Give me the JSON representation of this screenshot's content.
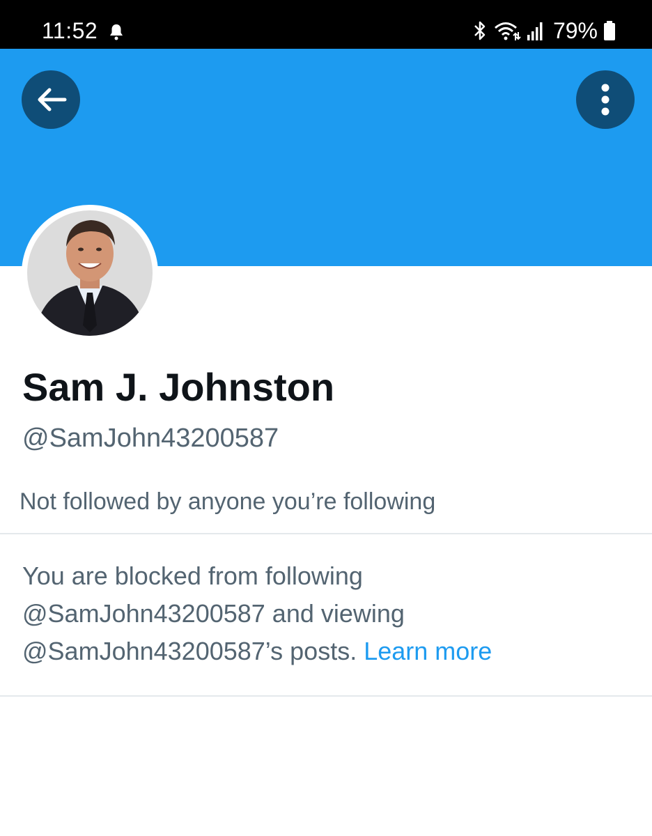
{
  "status_bar": {
    "time": "11:52",
    "battery": "79%",
    "icons": [
      "notification-bell-icon",
      "bluetooth-icon",
      "wifi-icon",
      "cellular-signal-icon",
      "battery-icon"
    ]
  },
  "colors": {
    "banner": "#1d9bf0",
    "round_button": "#0f4d77",
    "name_text": "#0f1419",
    "secondary_text": "#536471",
    "link": "#1d9bf0",
    "divider": "#e4e9ec"
  },
  "header": {
    "back_icon": "arrow-left-icon",
    "more_icon": "more-vertical-icon"
  },
  "profile": {
    "name": "Sam J. Johnston",
    "handle": "@SamJohn43200587",
    "followed_by": "Not followed by anyone you’re following"
  },
  "blocked_notice": {
    "line1": "You are blocked from following",
    "line2": "@SamJohn43200587 and viewing",
    "line3": "@SamJohn43200587’s posts.",
    "link": "Learn more"
  }
}
